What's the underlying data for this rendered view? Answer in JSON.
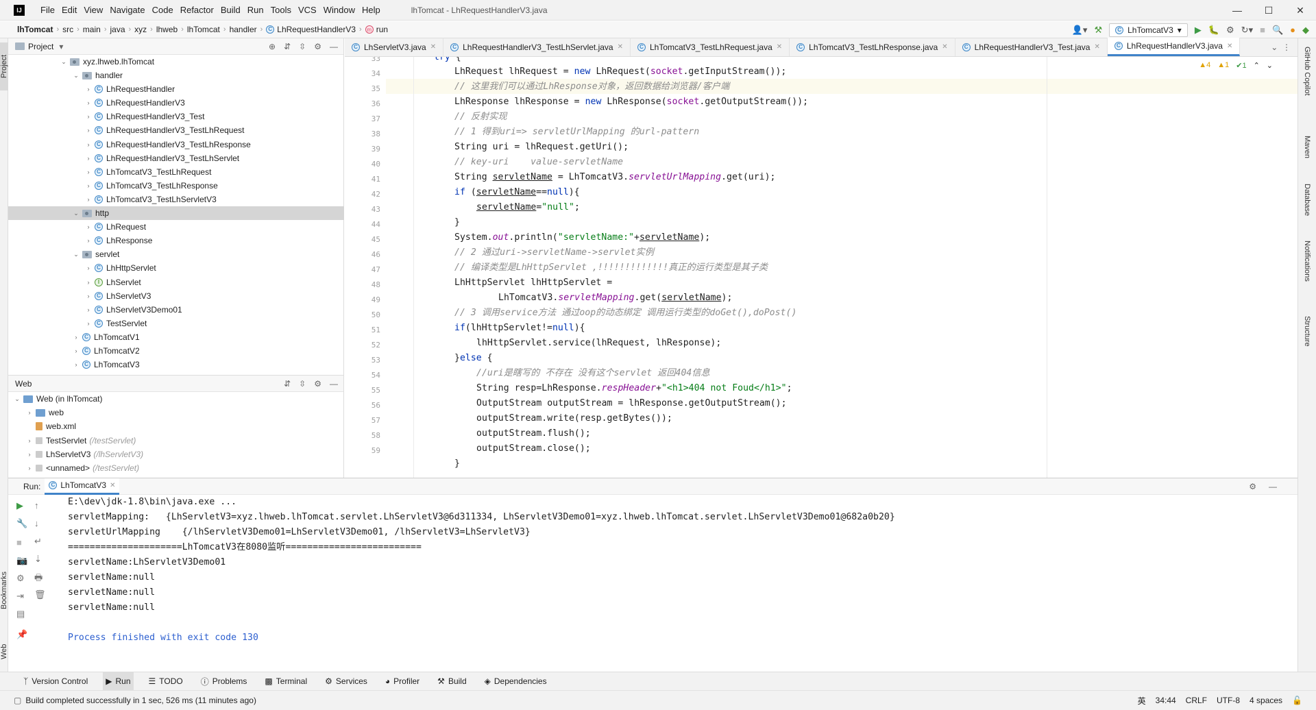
{
  "window": {
    "title": "lhTomcat - LhRequestHandlerV3.java",
    "menu": [
      "File",
      "Edit",
      "View",
      "Navigate",
      "Code",
      "Refactor",
      "Build",
      "Run",
      "Tools",
      "VCS",
      "Window",
      "Help"
    ]
  },
  "breadcrumb": {
    "items": [
      "lhTomcat",
      "src",
      "main",
      "java",
      "xyz",
      "lhweb",
      "lhTomcat",
      "handler",
      "LhRequestHandlerV3",
      "run"
    ],
    "run_config": "LhTomcatV3"
  },
  "project_panel": {
    "title": "Project",
    "root": "xyz.lhweb.lhTomcat",
    "tree": [
      {
        "label": "handler",
        "kind": "folder"
      },
      {
        "label": "LhRequestHandler",
        "kind": "class"
      },
      {
        "label": "LhRequestHandlerV3",
        "kind": "class"
      },
      {
        "label": "LhRequestHandlerV3_Test",
        "kind": "class"
      },
      {
        "label": "LhRequestHandlerV3_TestLhRequest",
        "kind": "class"
      },
      {
        "label": "LhRequestHandlerV3_TestLhResponse",
        "kind": "class"
      },
      {
        "label": "LhRequestHandlerV3_TestLhServlet",
        "kind": "class"
      },
      {
        "label": "LhTomcatV3_TestLhRequest",
        "kind": "class"
      },
      {
        "label": "LhTomcatV3_TestLhResponse",
        "kind": "class"
      },
      {
        "label": "LhTomcatV3_TestLhServletV3",
        "kind": "class"
      },
      {
        "label": "http",
        "kind": "folder"
      },
      {
        "label": "LhRequest",
        "kind": "class"
      },
      {
        "label": "LhResponse",
        "kind": "class"
      },
      {
        "label": "servlet",
        "kind": "folder"
      },
      {
        "label": "LhHttpServlet",
        "kind": "class"
      },
      {
        "label": "LhServlet",
        "kind": "interface"
      },
      {
        "label": "LhServletV3",
        "kind": "class"
      },
      {
        "label": "LhServletV3Demo01",
        "kind": "class"
      },
      {
        "label": "TestServlet",
        "kind": "class"
      },
      {
        "label": "LhTomcatV1",
        "kind": "class"
      },
      {
        "label": "LhTomcatV2",
        "kind": "class"
      },
      {
        "label": "LhTomcatV3",
        "kind": "class"
      }
    ]
  },
  "web_panel": {
    "title": "Web",
    "items": [
      {
        "label": "Web (in lhTomcat)",
        "hint": ""
      },
      {
        "label": "web",
        "hint": ""
      },
      {
        "label": "web.xml",
        "hint": ""
      },
      {
        "label": "TestServlet",
        "hint": "(/testServlet)"
      },
      {
        "label": "LhServletV3",
        "hint": "(/lhServletV3)"
      },
      {
        "label": "<unnamed>",
        "hint": "(/testServlet)"
      }
    ]
  },
  "editor_tabs": [
    "LhServletV3.java",
    "LhRequestHandlerV3_TestLhServlet.java",
    "LhTomcatV3_TestLhRequest.java",
    "LhTomcatV3_TestLhResponse.java",
    "LhRequestHandlerV3_Test.java",
    "LhRequestHandlerV3.java"
  ],
  "editor": {
    "warnings": "4",
    "weak_warnings": "1",
    "ok_count": "1",
    "line_numbers": [
      "33",
      "34",
      "35",
      "36",
      "37",
      "38",
      "39",
      "40",
      "41",
      "42",
      "43",
      "44",
      "45",
      "46",
      "47",
      "48",
      "49",
      "50",
      "51",
      "52",
      "53",
      "54",
      "55",
      "56",
      "57",
      "58",
      "59"
    ]
  },
  "run_panel": {
    "label": "Run:",
    "tab": "LhTomcatV3",
    "output": [
      "E:\\dev\\jdk-1.8\\bin\\java.exe ...",
      "servletMapping:   {LhServletV3=xyz.lhweb.lhTomcat.servlet.LhServletV3@6d311334, LhServletV3Demo01=xyz.lhweb.lhTomcat.servlet.LhServletV3Demo01@682a0b20}",
      "servletUrlMapping    {/lhServletV3Demo01=LhServletV3Demo01, /lhServletV3=LhServletV3}",
      "=====================LhTomcatV3在8080监听=========================",
      "servletName:LhServletV3Demo01",
      "servletName:null",
      "servletName:null",
      "servletName:null",
      "",
      "Process finished with exit code 130"
    ]
  },
  "left_strip": [
    "Project",
    "Bookmarks",
    "Web"
  ],
  "right_strip": [
    "GitHub Copilot",
    "Maven",
    "Database",
    "Notifications",
    "Structure"
  ],
  "bottom_tabs": [
    "Version Control",
    "Run",
    "TODO",
    "Problems",
    "Terminal",
    "Services",
    "Profiler",
    "Build",
    "Dependencies"
  ],
  "status": {
    "message": "Build completed successfully in 1 sec, 526 ms (11 minutes ago)",
    "position": "34:44",
    "line_sep": "CRLF",
    "encoding": "UTF-8",
    "indent": "4 spaces",
    "ime": "英"
  },
  "colors": {
    "accent": "#4083c9",
    "keyword": "#0033b3",
    "comment": "#8c8c8c",
    "string": "#067d17",
    "field": "#871094"
  }
}
